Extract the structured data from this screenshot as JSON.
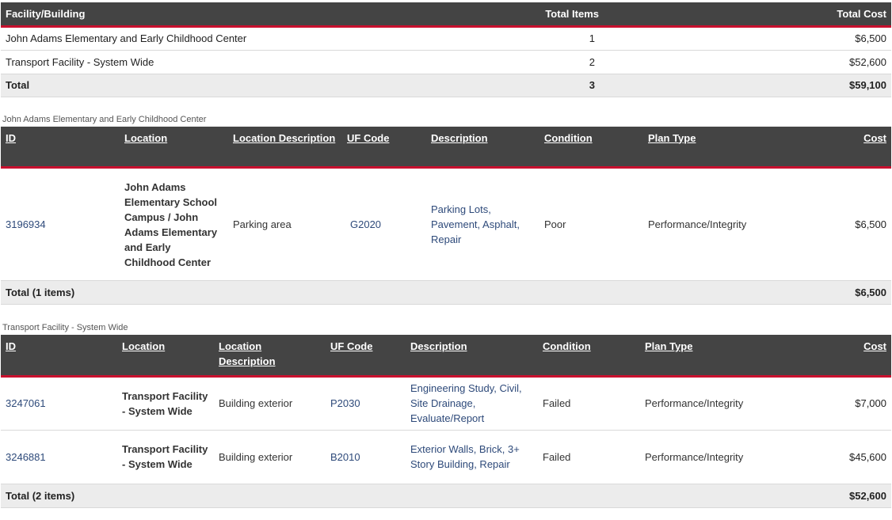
{
  "summary": {
    "headers": {
      "facility": "Facility/Building",
      "items": "Total Items",
      "cost": "Total Cost"
    },
    "rows": [
      {
        "facility": "John Adams Elementary and Early Childhood Center",
        "items": "1",
        "cost": "$6,500"
      },
      {
        "facility": "Transport Facility - System Wide",
        "items": "2",
        "cost": "$52,600"
      }
    ],
    "total": {
      "label": "Total",
      "items": "3",
      "cost": "$59,100"
    }
  },
  "detail_headers": {
    "id": "ID",
    "location": "Location",
    "location_desc": "Location Description",
    "uf_code": "UF Code",
    "description": "Description",
    "condition": "Condition",
    "plan_type": "Plan Type",
    "cost": "Cost"
  },
  "sections": [
    {
      "title": "John Adams Elementary and Early Childhood Center",
      "rows": [
        {
          "id": "3196934",
          "location": "John Adams Elementary School Campus / John Adams Elementary and Early Childhood Center",
          "location_desc": "Parking area",
          "uf_code": "G2020",
          "description": "Parking Lots, Pavement, Asphalt, Repair",
          "condition": "Poor",
          "plan_type": "Performance/Integrity",
          "cost": "$6,500"
        }
      ],
      "total": {
        "label": "Total (1 items)",
        "cost": "$6,500"
      }
    },
    {
      "title": "Transport Facility - System Wide",
      "rows": [
        {
          "id": "3247061",
          "location": "Transport Facility - System Wide",
          "location_desc": "Building exterior",
          "uf_code": "P2030",
          "description": "Engineering Study, Civil, Site Drainage, Evaluate/Report",
          "condition": "Failed",
          "plan_type": "Performance/Integrity",
          "cost": "$7,000"
        },
        {
          "id": "3246881",
          "location": "Transport Facility - System Wide",
          "location_desc": "Building exterior",
          "uf_code": "B2010",
          "description": "Exterior Walls, Brick, 3+ Story Building, Repair",
          "condition": "Failed",
          "plan_type": "Performance/Integrity",
          "cost": "$45,600"
        }
      ],
      "total": {
        "label": "Total (2 items)",
        "cost": "$52,600"
      }
    }
  ]
}
